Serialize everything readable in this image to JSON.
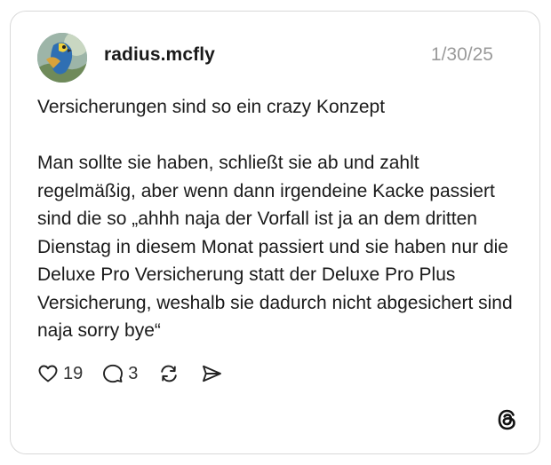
{
  "post": {
    "username": "radius.mcfly",
    "date": "1/30/25",
    "text": "Versicherungen sind so ein crazy Konzept\n\nMan sollte sie haben, schließt sie ab und zahlt regelmäßig, aber wenn dann irgendeine Kacke passiert sind die so „ahhh naja der Vorfall ist ja an dem dritten Dienstag in diesem Monat passiert und sie haben nur die Deluxe Pro Versicherung statt der Deluxe Pro Plus Versicherung, weshalb sie dadurch nicht abgesichert sind naja sorry bye“"
  },
  "actions": {
    "like_icon": "heart-icon",
    "like_count": "19",
    "reply_icon": "speech-bubble-icon",
    "reply_count": "3",
    "repost_icon": "repost-icon",
    "share_icon": "send-icon"
  },
  "branding": {
    "logo_icon": "threads-logo"
  },
  "colors": {
    "text": "#1a1a1a",
    "muted": "#9a9a9a",
    "border": "#d9d9d9"
  }
}
